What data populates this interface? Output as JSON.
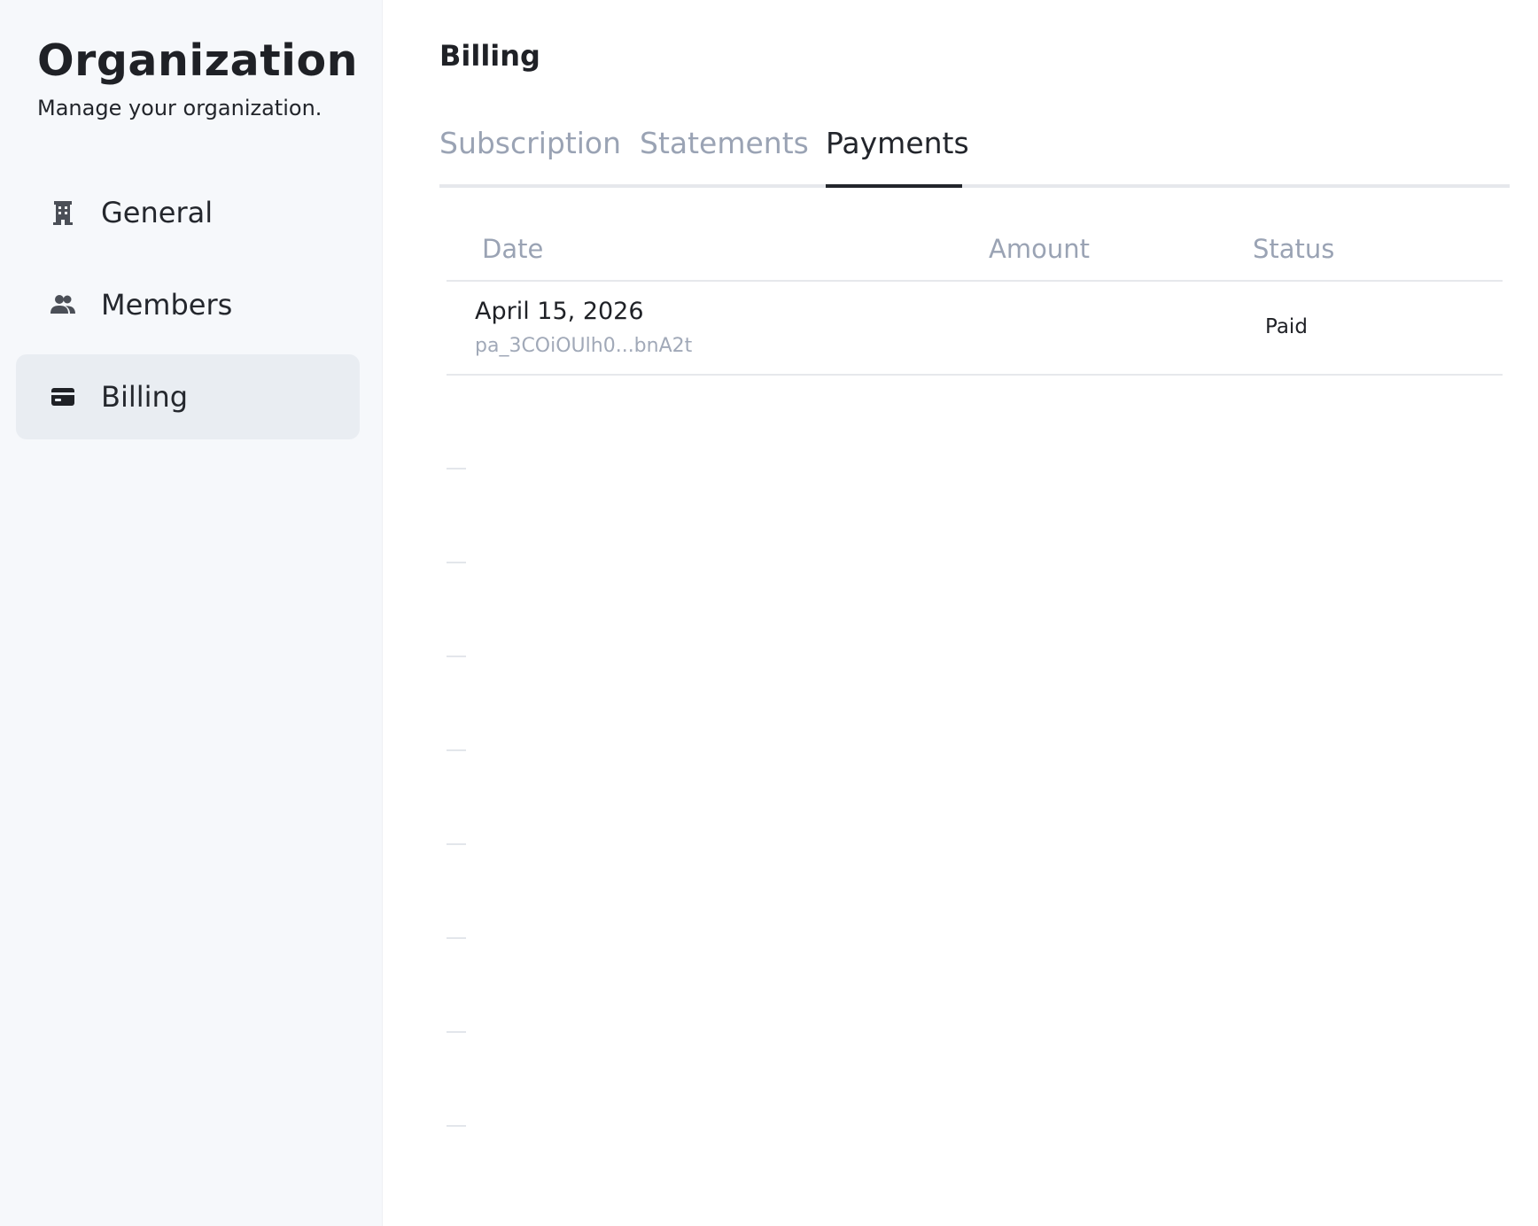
{
  "sidebar": {
    "title": "Organization",
    "subtitle": "Manage your organization.",
    "items": [
      {
        "label": "General",
        "icon": "building-icon",
        "active": false
      },
      {
        "label": "Members",
        "icon": "users-icon",
        "active": false
      },
      {
        "label": "Billing",
        "icon": "credit-card-icon",
        "active": true
      }
    ]
  },
  "main": {
    "title": "Billing",
    "tabs": [
      {
        "label": "Subscription",
        "active": false
      },
      {
        "label": "Statements",
        "active": false
      },
      {
        "label": "Payments",
        "active": true
      }
    ],
    "table": {
      "headers": {
        "date": "Date",
        "amount": "Amount",
        "status": "Status"
      },
      "rows": [
        {
          "date": "April 15, 2026",
          "id": "pa_3COiOUlh0...bnA2t",
          "amount": "",
          "status": "Paid"
        }
      ]
    }
  },
  "colors": {
    "sidebar_bg": "#f6f8fb",
    "active_item_bg": "#e9edf2",
    "muted_text": "#9aa3b4",
    "primary_text": "#1f2126",
    "divider": "#e6e8ec"
  }
}
